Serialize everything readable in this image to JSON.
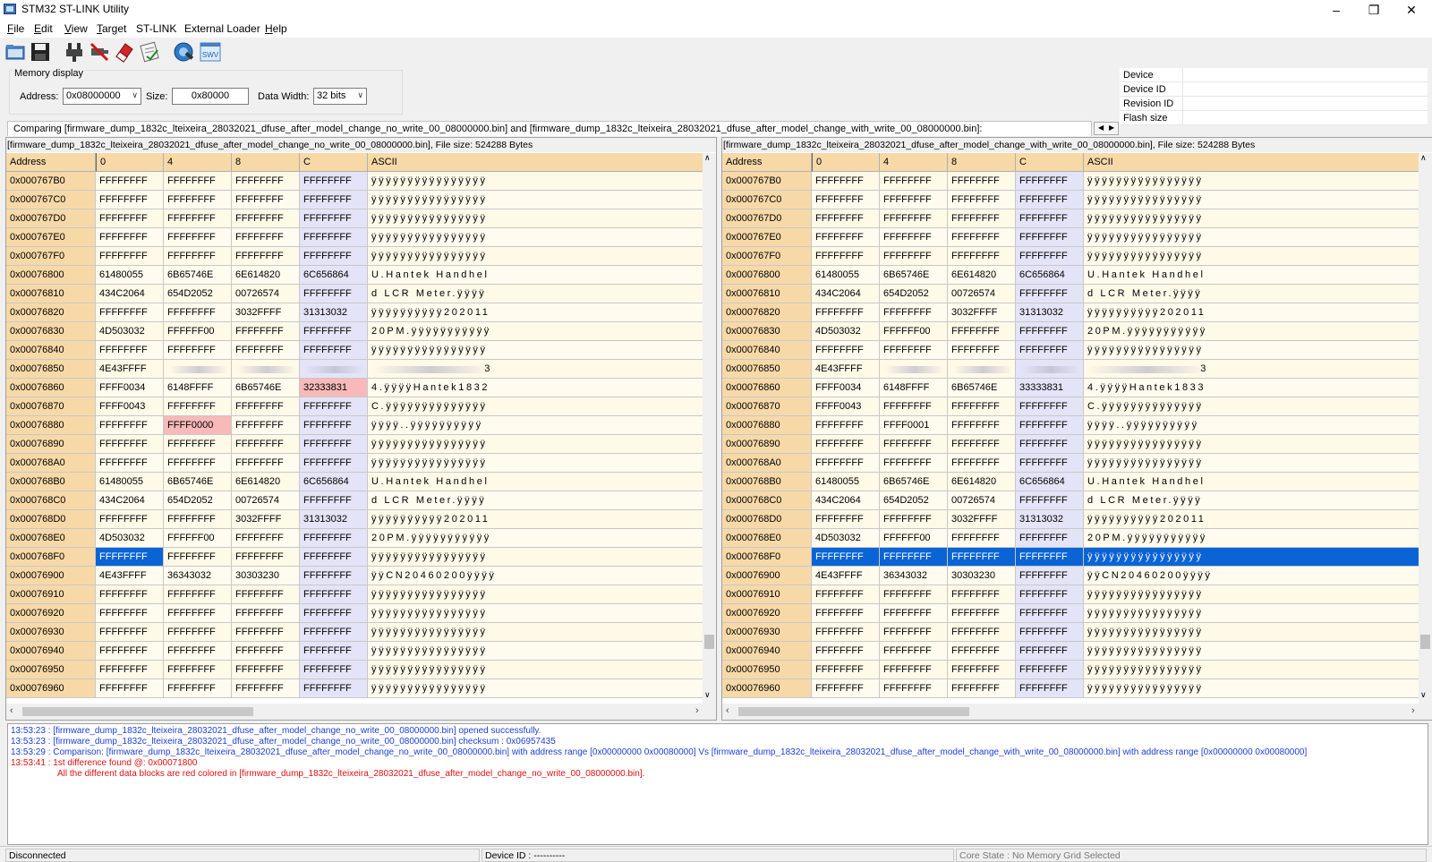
{
  "window": {
    "title": "STM32 ST-LINK Utility"
  },
  "menu": [
    {
      "pre": "",
      "acc": "F",
      "post": "ile"
    },
    {
      "pre": "",
      "acc": "E",
      "post": "dit"
    },
    {
      "pre": "",
      "acc": "V",
      "post": "iew"
    },
    {
      "pre": "",
      "acc": "T",
      "post": "arget"
    },
    {
      "pre": "ST-LINK",
      "acc": "",
      "post": ""
    },
    {
      "pre": "External Loader",
      "acc": "",
      "post": ""
    },
    {
      "pre": "",
      "acc": "H",
      "post": "elp"
    }
  ],
  "toolbar_icons": [
    "open-icon",
    "save-icon",
    "connect-icon",
    "disconnect-icon",
    "erase-icon",
    "program-verify-icon",
    "core-icon",
    "swv-icon"
  ],
  "toolbar_swv_text": "SWV",
  "memory_display": {
    "title": "Memory display",
    "address_label": "Address:",
    "address": "0x08000000",
    "size_label": "Size:",
    "size": "0x80000",
    "width_label": "Data Width:",
    "width": "32 bits"
  },
  "device_info": [
    "Device",
    "Device ID",
    "Revision ID",
    "Flash size"
  ],
  "compare_title": "Comparing [firmware_dump_1832c_lteixeira_28032021_dfuse_after_model_change_no_write_00_08000000.bin] and [firmware_dump_1832c_lteixeira_28032021_dfuse_after_model_change_with_write_00_08000000.bin]:",
  "left": {
    "file": "[firmware_dump_1832c_lteixeira_28032021_dfuse_after_model_change_no_write_00_08000000.bin], File size: 524288 Bytes",
    "headers": [
      "Address",
      "0",
      "4",
      "8",
      "C",
      "ASCII"
    ],
    "rows": [
      [
        "0x000767B0",
        "FFFFFFFF",
        "FFFFFFFF",
        "FFFFFFFF",
        "FFFFFFFF",
        "ÿÿÿÿÿÿÿÿÿÿÿÿÿÿÿÿ"
      ],
      [
        "0x000767C0",
        "FFFFFFFF",
        "FFFFFFFF",
        "FFFFFFFF",
        "FFFFFFFF",
        "ÿÿÿÿÿÿÿÿÿÿÿÿÿÿÿÿ"
      ],
      [
        "0x000767D0",
        "FFFFFFFF",
        "FFFFFFFF",
        "FFFFFFFF",
        "FFFFFFFF",
        "ÿÿÿÿÿÿÿÿÿÿÿÿÿÿÿÿ"
      ],
      [
        "0x000767E0",
        "FFFFFFFF",
        "FFFFFFFF",
        "FFFFFFFF",
        "FFFFFFFF",
        "ÿÿÿÿÿÿÿÿÿÿÿÿÿÿÿÿ"
      ],
      [
        "0x000767F0",
        "FFFFFFFF",
        "FFFFFFFF",
        "FFFFFFFF",
        "FFFFFFFF",
        "ÿÿÿÿÿÿÿÿÿÿÿÿÿÿÿÿ"
      ],
      [
        "0x00076800",
        "61480055",
        "6B65746E",
        "6E614820",
        "6C656864",
        "U.Hantek Handhel"
      ],
      [
        "0x00076810",
        "434C2064",
        "654D2052",
        "00726574",
        "FFFFFFFF",
        "d LCR Meter.ÿÿÿÿ"
      ],
      [
        "0x00076820",
        "FFFFFFFF",
        "FFFFFFFF",
        "3032FFFF",
        "31313032",
        "ÿÿÿÿÿÿÿÿÿÿ202011"
      ],
      [
        "0x00076830",
        "4D503032",
        "FFFFFF00",
        "FFFFFFFF",
        "FFFFFFFF",
        "20PM.ÿÿÿÿÿÿÿÿÿÿÿ"
      ],
      [
        "0x00076840",
        "FFFFFFFF",
        "FFFFFFFF",
        "FFFFFFFF",
        "FFFFFFFF",
        "ÿÿÿÿÿÿÿÿÿÿÿÿÿÿÿÿ"
      ],
      [
        "0x00076850",
        "4E43FFFF",
        "",
        "",
        "",
        "3"
      ],
      [
        "0x00076860",
        "FFFF0034",
        "6148FFFF",
        "6B65746E",
        "32333831",
        "4.ÿÿÿÿHantek1832"
      ],
      [
        "0x00076870",
        "FFFF0043",
        "FFFFFFFF",
        "FFFFFFFF",
        "FFFFFFFF",
        "C.ÿÿÿÿÿÿÿÿÿÿÿÿÿÿ"
      ],
      [
        "0x00076880",
        "FFFFFFFF",
        "FFFF0000",
        "FFFFFFFF",
        "FFFFFFFF",
        "ÿÿÿÿ..ÿÿÿÿÿÿÿÿÿÿ"
      ],
      [
        "0x00076890",
        "FFFFFFFF",
        "FFFFFFFF",
        "FFFFFFFF",
        "FFFFFFFF",
        "ÿÿÿÿÿÿÿÿÿÿÿÿÿÿÿÿ"
      ],
      [
        "0x000768A0",
        "FFFFFFFF",
        "FFFFFFFF",
        "FFFFFFFF",
        "FFFFFFFF",
        "ÿÿÿÿÿÿÿÿÿÿÿÿÿÿÿÿ"
      ],
      [
        "0x000768B0",
        "61480055",
        "6B65746E",
        "6E614820",
        "6C656864",
        "U.Hantek Handhel"
      ],
      [
        "0x000768C0",
        "434C2064",
        "654D2052",
        "00726574",
        "FFFFFFFF",
        "d LCR Meter.ÿÿÿÿ"
      ],
      [
        "0x000768D0",
        "FFFFFFFF",
        "FFFFFFFF",
        "3032FFFF",
        "31313032",
        "ÿÿÿÿÿÿÿÿÿÿ202011"
      ],
      [
        "0x000768E0",
        "4D503032",
        "FFFFFF00",
        "FFFFFFFF",
        "FFFFFFFF",
        "20PM.ÿÿÿÿÿÿÿÿÿÿÿ"
      ],
      [
        "0x000768F0",
        "FFFFFFFF",
        "FFFFFFFF",
        "FFFFFFFF",
        "FFFFFFFF",
        "ÿÿÿÿÿÿÿÿÿÿÿÿÿÿÿÿ"
      ],
      [
        "0x00076900",
        "4E43FFFF",
        "36343032",
        "30303230",
        "FFFFFFFF",
        "ÿÿCN20460200ÿÿÿÿ"
      ],
      [
        "0x00076910",
        "FFFFFFFF",
        "FFFFFFFF",
        "FFFFFFFF",
        "FFFFFFFF",
        "ÿÿÿÿÿÿÿÿÿÿÿÿÿÿÿÿ"
      ],
      [
        "0x00076920",
        "FFFFFFFF",
        "FFFFFFFF",
        "FFFFFFFF",
        "FFFFFFFF",
        "ÿÿÿÿÿÿÿÿÿÿÿÿÿÿÿÿ"
      ],
      [
        "0x00076930",
        "FFFFFFFF",
        "FFFFFFFF",
        "FFFFFFFF",
        "FFFFFFFF",
        "ÿÿÿÿÿÿÿÿÿÿÿÿÿÿÿÿ"
      ],
      [
        "0x00076940",
        "FFFFFFFF",
        "FFFFFFFF",
        "FFFFFFFF",
        "FFFFFFFF",
        "ÿÿÿÿÿÿÿÿÿÿÿÿÿÿÿÿ"
      ],
      [
        "0x00076950",
        "FFFFFFFF",
        "FFFFFFFF",
        "FFFFFFFF",
        "FFFFFFFF",
        "ÿÿÿÿÿÿÿÿÿÿÿÿÿÿÿÿ"
      ],
      [
        "0x00076960",
        "FFFFFFFF",
        "FFFFFFFF",
        "FFFFFFFF",
        "FFFFFFFF",
        "ÿÿÿÿÿÿÿÿÿÿÿÿÿÿÿÿ"
      ]
    ]
  },
  "right": {
    "file": "[firmware_dump_1832c_lteixeira_28032021_dfuse_after_model_change_with_write_00_08000000.bin], File size: 524288 Bytes",
    "headers": [
      "Address",
      "0",
      "4",
      "8",
      "C",
      "ASCII"
    ],
    "rows": [
      [
        "0x000767B0",
        "FFFFFFFF",
        "FFFFFFFF",
        "FFFFFFFF",
        "FFFFFFFF",
        "ÿÿÿÿÿÿÿÿÿÿÿÿÿÿÿÿ"
      ],
      [
        "0x000767C0",
        "FFFFFFFF",
        "FFFFFFFF",
        "FFFFFFFF",
        "FFFFFFFF",
        "ÿÿÿÿÿÿÿÿÿÿÿÿÿÿÿÿ"
      ],
      [
        "0x000767D0",
        "FFFFFFFF",
        "FFFFFFFF",
        "FFFFFFFF",
        "FFFFFFFF",
        "ÿÿÿÿÿÿÿÿÿÿÿÿÿÿÿÿ"
      ],
      [
        "0x000767E0",
        "FFFFFFFF",
        "FFFFFFFF",
        "FFFFFFFF",
        "FFFFFFFF",
        "ÿÿÿÿÿÿÿÿÿÿÿÿÿÿÿÿ"
      ],
      [
        "0x000767F0",
        "FFFFFFFF",
        "FFFFFFFF",
        "FFFFFFFF",
        "FFFFFFFF",
        "ÿÿÿÿÿÿÿÿÿÿÿÿÿÿÿÿ"
      ],
      [
        "0x00076800",
        "61480055",
        "6B65746E",
        "6E614820",
        "6C656864",
        "U.Hantek Handhel"
      ],
      [
        "0x00076810",
        "434C2064",
        "654D2052",
        "00726574",
        "FFFFFFFF",
        "d LCR Meter.ÿÿÿÿ"
      ],
      [
        "0x00076820",
        "FFFFFFFF",
        "FFFFFFFF",
        "3032FFFF",
        "31313032",
        "ÿÿÿÿÿÿÿÿÿÿ202011"
      ],
      [
        "0x00076830",
        "4D503032",
        "FFFFFF00",
        "FFFFFFFF",
        "FFFFFFFF",
        "20PM.ÿÿÿÿÿÿÿÿÿÿÿ"
      ],
      [
        "0x00076840",
        "FFFFFFFF",
        "FFFFFFFF",
        "FFFFFFFF",
        "FFFFFFFF",
        "ÿÿÿÿÿÿÿÿÿÿÿÿÿÿÿÿ"
      ],
      [
        "0x00076850",
        "4E43FFFF",
        "",
        "",
        "",
        "3"
      ],
      [
        "0x00076860",
        "FFFF0034",
        "6148FFFF",
        "6B65746E",
        "33333831",
        "4.ÿÿÿÿHantek1833"
      ],
      [
        "0x00076870",
        "FFFF0043",
        "FFFFFFFF",
        "FFFFFFFF",
        "FFFFFFFF",
        "C.ÿÿÿÿÿÿÿÿÿÿÿÿÿÿ"
      ],
      [
        "0x00076880",
        "FFFFFFFF",
        "FFFF0001",
        "FFFFFFFF",
        "FFFFFFFF",
        "ÿÿÿÿ..ÿÿÿÿÿÿÿÿÿÿ"
      ],
      [
        "0x00076890",
        "FFFFFFFF",
        "FFFFFFFF",
        "FFFFFFFF",
        "FFFFFFFF",
        "ÿÿÿÿÿÿÿÿÿÿÿÿÿÿÿÿ"
      ],
      [
        "0x000768A0",
        "FFFFFFFF",
        "FFFFFFFF",
        "FFFFFFFF",
        "FFFFFFFF",
        "ÿÿÿÿÿÿÿÿÿÿÿÿÿÿÿÿ"
      ],
      [
        "0x000768B0",
        "61480055",
        "6B65746E",
        "6E614820",
        "6C656864",
        "U.Hantek Handhel"
      ],
      [
        "0x000768C0",
        "434C2064",
        "654D2052",
        "00726574",
        "FFFFFFFF",
        "d LCR Meter.ÿÿÿÿ"
      ],
      [
        "0x000768D0",
        "FFFFFFFF",
        "FFFFFFFF",
        "3032FFFF",
        "31313032",
        "ÿÿÿÿÿÿÿÿÿÿ202011"
      ],
      [
        "0x000768E0",
        "4D503032",
        "FFFFFF00",
        "FFFFFFFF",
        "FFFFFFFF",
        "20PM.ÿÿÿÿÿÿÿÿÿÿÿ"
      ],
      [
        "0x000768F0",
        "FFFFFFFF",
        "FFFFFFFF",
        "FFFFFFFF",
        "FFFFFFFF",
        "ÿÿÿÿÿÿÿÿÿÿÿÿÿÿÿÿ"
      ],
      [
        "0x00076900",
        "4E43FFFF",
        "36343032",
        "30303230",
        "FFFFFFFF",
        "ÿÿCN20460200ÿÿÿÿ"
      ],
      [
        "0x00076910",
        "FFFFFFFF",
        "FFFFFFFF",
        "FFFFFFFF",
        "FFFFFFFF",
        "ÿÿÿÿÿÿÿÿÿÿÿÿÿÿÿÿ"
      ],
      [
        "0x00076920",
        "FFFFFFFF",
        "FFFFFFFF",
        "FFFFFFFF",
        "FFFFFFFF",
        "ÿÿÿÿÿÿÿÿÿÿÿÿÿÿÿÿ"
      ],
      [
        "0x00076930",
        "FFFFFFFF",
        "FFFFFFFF",
        "FFFFFFFF",
        "FFFFFFFF",
        "ÿÿÿÿÿÿÿÿÿÿÿÿÿÿÿÿ"
      ],
      [
        "0x00076940",
        "FFFFFFFF",
        "FFFFFFFF",
        "FFFFFFFF",
        "FFFFFFFF",
        "ÿÿÿÿÿÿÿÿÿÿÿÿÿÿÿÿ"
      ],
      [
        "0x00076950",
        "FFFFFFFF",
        "FFFFFFFF",
        "FFFFFFFF",
        "FFFFFFFF",
        "ÿÿÿÿÿÿÿÿÿÿÿÿÿÿÿÿ"
      ],
      [
        "0x00076960",
        "FFFFFFFF",
        "FFFFFFFF",
        "FFFFFFFF",
        "FFFFFFFF",
        "ÿÿÿÿÿÿÿÿÿÿÿÿÿÿÿÿ"
      ]
    ]
  },
  "diff_cells": [
    [
      11,
      4
    ],
    [
      13,
      2
    ]
  ],
  "selected_row": 20,
  "log": [
    {
      "color": "blue",
      "text": "13:53:23 : [firmware_dump_1832c_lteixeira_28032021_dfuse_after_model_change_no_write_00_08000000.bin] opened successfully."
    },
    {
      "color": "blue",
      "text": "13:53:23 : [firmware_dump_1832c_lteixeira_28032021_dfuse_after_model_change_no_write_00_08000000.bin] checksum : 0x06957435"
    },
    {
      "color": "blue",
      "text": "13:53:29 : Comparison: [firmware_dump_1832c_lteixeira_28032021_dfuse_after_model_change_no_write_00_08000000.bin] with address range [0x00000000 0x00080000] Vs [firmware_dump_1832c_lteixeira_28032021_dfuse_after_model_change_with_write_00_08000000.bin] with address range [0x00000000 0x00080000]"
    },
    {
      "color": "red",
      "text": "13:53:41 : 1st difference found @: 0x00071800"
    },
    {
      "color": "red",
      "indent": true,
      "text": "All the different data blocks are red colored in [firmware_dump_1832c_lteixeira_28032021_dfuse_after_model_change_no_write_00_08000000.bin]."
    }
  ],
  "status": {
    "connection": "Disconnected",
    "device_id": "Device ID : ----------",
    "core_state": "Core State : No Memory Grid Selected"
  },
  "colors": {
    "header": "#f7d9a8",
    "diff": "#f7b9b9",
    "selection": "#0a64d6",
    "log_blue": "#1a3fd6",
    "log_red": "#e01010"
  }
}
